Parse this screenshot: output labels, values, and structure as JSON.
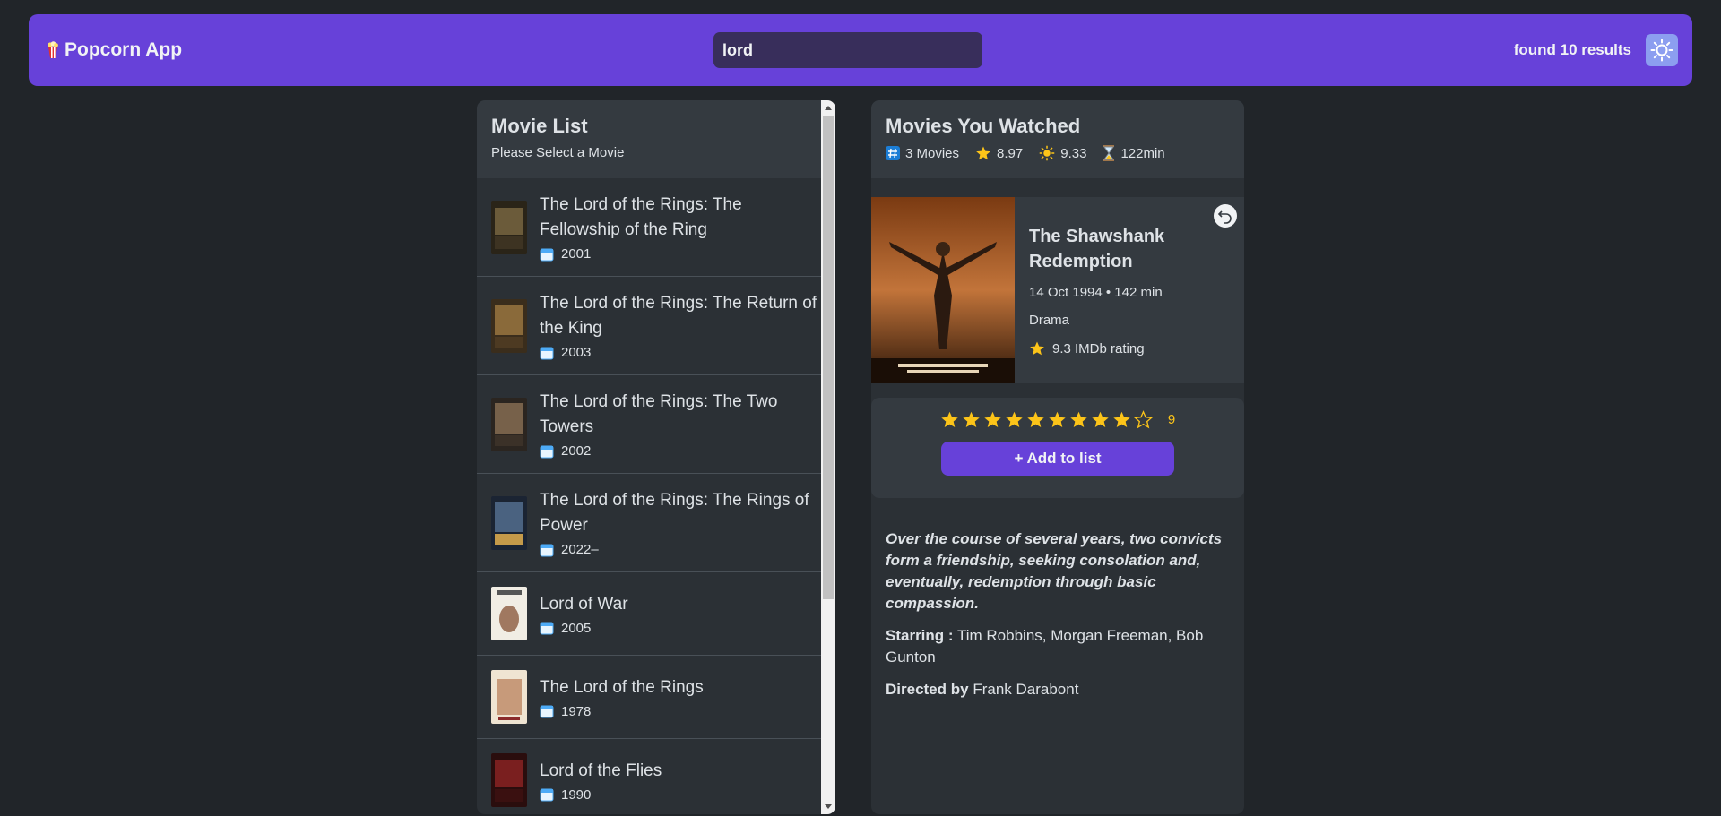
{
  "app": {
    "title": "Popcorn App"
  },
  "search": {
    "value": "lord",
    "results_label": "found 10 results"
  },
  "list": {
    "title": "Movie List",
    "subtitle": "Please Select a Movie",
    "movies": [
      {
        "title": "The Lord of the Rings: The Fellowship of the Ring",
        "year": "2001"
      },
      {
        "title": "The Lord of the Rings: The Return of the King",
        "year": "2003"
      },
      {
        "title": "The Lord of the Rings: The Two Towers",
        "year": "2002"
      },
      {
        "title": "The Lord of the Rings: The Rings of Power",
        "year": "2022–"
      },
      {
        "title": "Lord of War",
        "year": "2005"
      },
      {
        "title": "The Lord of the Rings",
        "year": "1978"
      },
      {
        "title": "Lord of the Flies",
        "year": "1990"
      }
    ]
  },
  "watched": {
    "title": "Movies You Watched",
    "count": "3 Movies",
    "imdb_avg": "8.97",
    "user_avg": "9.33",
    "runtime": "122min"
  },
  "details": {
    "title": "The Shawshank Redemption",
    "released_runtime": "14 Oct 1994 • 142 min",
    "genre": "Drama",
    "imdb": "9.3 IMDb rating",
    "user_rating": 9,
    "max_rating": 10,
    "add_label": "+ Add to list",
    "plot": "Over the course of several years, two convicts form a friendship, seeking consolation and, eventually, redemption through basic compassion.",
    "starring_label": "Starring :",
    "starring": "Tim Robbins, Morgan Freeman, Bob Gunton",
    "directed_label": "Directed by",
    "director": "Frank Darabont"
  },
  "icons": {
    "logo": "popcorn-icon",
    "theme": "sun-icon",
    "back": "back-arrow-icon",
    "year": "calendar-icon",
    "count": "hash-icon",
    "imdb": "star-icon",
    "user": "sparkle-icon",
    "runtime": "hourglass-icon"
  },
  "colors": {
    "accent": "#6741d9",
    "star": "#fcc419",
    "background": "#212529"
  }
}
